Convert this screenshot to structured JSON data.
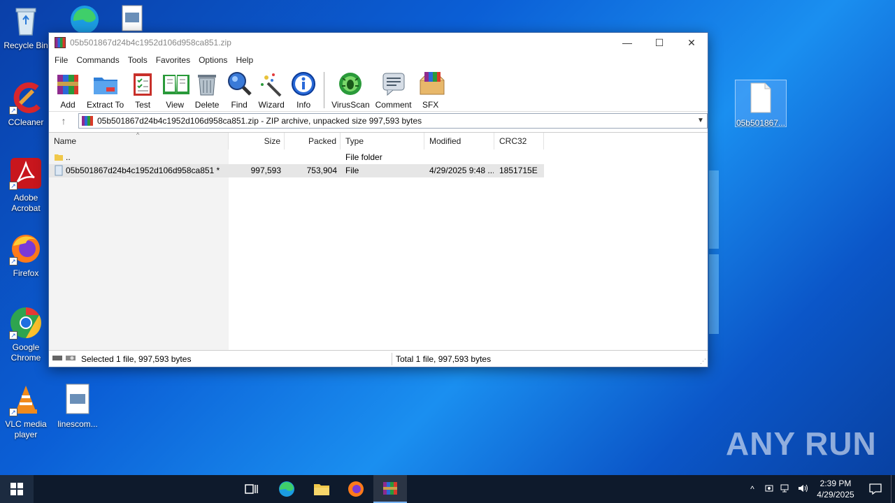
{
  "desktop": {
    "icons": [
      {
        "label": "Recycle Bin"
      },
      {
        "label": "CCleaner"
      },
      {
        "label": "Adobe Acrobat"
      },
      {
        "label": "Firefox"
      },
      {
        "label": "Google Chrome"
      },
      {
        "label": "VLC media player"
      },
      {
        "label": "linescom..."
      },
      {
        "label": "05b501867..."
      }
    ],
    "watermark": "ANY RUN"
  },
  "window": {
    "title": "05b501867d24b4c1952d106d958ca851.zip",
    "controls": {
      "minimize": "—",
      "maximize": "☐",
      "close": "✕"
    },
    "menu": [
      "File",
      "Commands",
      "Tools",
      "Favorites",
      "Options",
      "Help"
    ],
    "toolbar": [
      {
        "label": "Add",
        "icon": "add-archive-icon"
      },
      {
        "label": "Extract To",
        "icon": "extract-folder-icon"
      },
      {
        "label": "Test",
        "icon": "test-clipboard-icon"
      },
      {
        "label": "View",
        "icon": "view-book-icon"
      },
      {
        "label": "Delete",
        "icon": "delete-trash-icon"
      },
      {
        "label": "Find",
        "icon": "find-magnifier-icon"
      },
      {
        "label": "Wizard",
        "icon": "wizard-wand-icon"
      },
      {
        "label": "Info",
        "icon": "info-icon"
      },
      {
        "label": "VirusScan",
        "icon": "virusscan-bug-icon"
      },
      {
        "label": "Comment",
        "icon": "comment-icon"
      },
      {
        "label": "SFX",
        "icon": "sfx-box-icon"
      }
    ],
    "address": "05b501867d24b4c1952d106d958ca851.zip - ZIP archive, unpacked size 997,593 bytes",
    "columns": [
      "Name",
      "Size",
      "Packed",
      "Type",
      "Modified",
      "CRC32"
    ],
    "rows": [
      {
        "name": "..",
        "size": "",
        "packed": "",
        "type": "File folder",
        "modified": "",
        "crc": ""
      },
      {
        "name": "05b501867d24b4c1952d106d958ca851 *",
        "size": "997,593",
        "packed": "753,904",
        "type": "File",
        "modified": "4/29/2025 9:48 ...",
        "crc": "1851715E"
      }
    ],
    "status": {
      "left": "Selected 1 file, 997,593 bytes",
      "right": "Total 1 file, 997,593 bytes"
    }
  },
  "taskbar": {
    "time": "2:39 PM",
    "date": "4/29/2025"
  },
  "colors": {
    "desktop": "#0b5fd6",
    "taskbar": "#0e1a2c",
    "selection": "#e6e6e6"
  }
}
